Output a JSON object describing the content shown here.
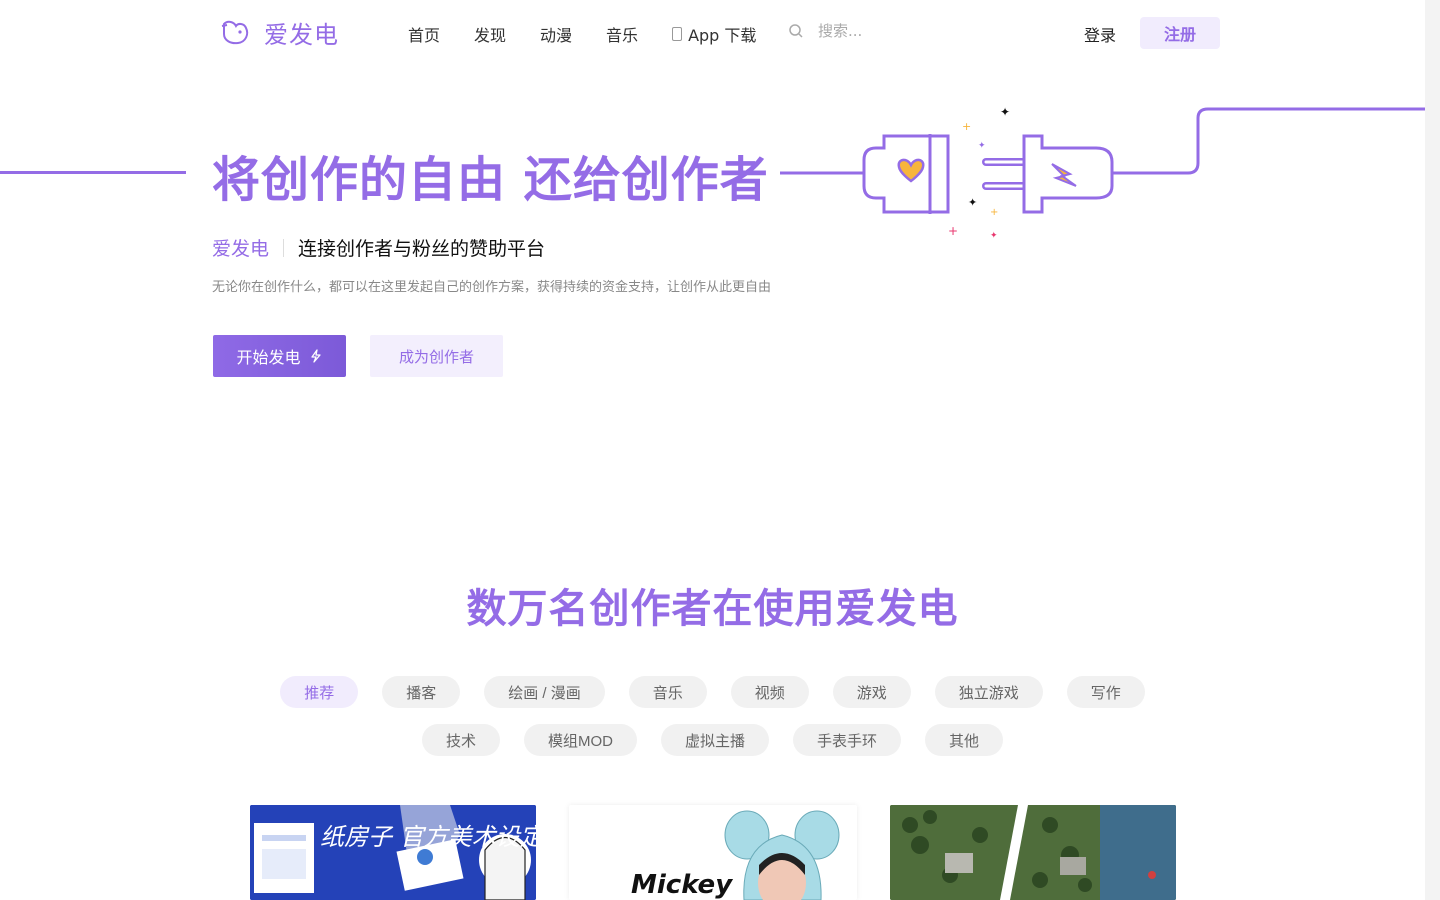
{
  "header": {
    "logo_text": "爱发电",
    "nav": [
      {
        "label": "首页"
      },
      {
        "label": "发现"
      },
      {
        "label": "动漫"
      },
      {
        "label": "音乐"
      },
      {
        "label": "App 下载",
        "icon": "phone-icon"
      }
    ],
    "search_placeholder": "搜索...",
    "login_label": "登录",
    "register_label": "注册"
  },
  "hero": {
    "title": "将创作的自由 还给创作者",
    "tag_brand": "爱发电",
    "tag_main": "连接创作者与粉丝的赞助平台",
    "subtitle": "无论你在创作什么，都可以在这里发起自己的创作方案，获得持续的资金支持，让创作从此更自由",
    "start_label": "开始发电",
    "creator_label": "成为创作者"
  },
  "section": {
    "title": "数万名创作者在使用爱发电",
    "categories_row1": [
      "推荐",
      "播客",
      "绘画 / 漫画",
      "音乐",
      "视频",
      "游戏",
      "独立游戏",
      "写作"
    ],
    "categories_row2": [
      "技术",
      "模组MOD",
      "虚拟主播",
      "手表手环",
      "其他"
    ],
    "active_category": "推荐"
  },
  "cards": [
    {
      "name": "card-art-book",
      "caption": "纸房子 官方美术设定集"
    },
    {
      "name": "card-mickey",
      "caption": "Mickey"
    },
    {
      "name": "card-game-map",
      "caption": ""
    }
  ],
  "colors": {
    "accent": "#946ce6",
    "accent_light": "#f1ecfd",
    "chip_bg": "#f1f1f1"
  }
}
